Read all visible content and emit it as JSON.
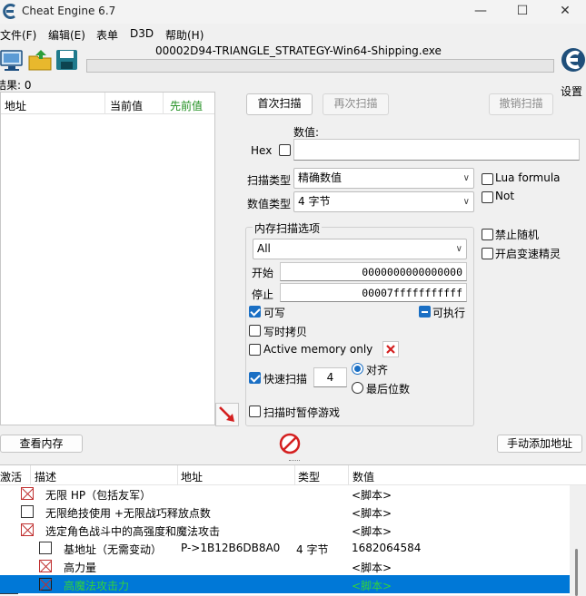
{
  "window": {
    "title": "Cheat Engine 6.7",
    "min": "—",
    "max": "☐",
    "close": "✕"
  },
  "menu": [
    "文件(F)",
    "编辑(E)",
    "表单",
    "D3D",
    "帮助(H)"
  ],
  "process": {
    "name": "00002D94-TRIANGLE_STRATEGY-Win64-Shipping.exe"
  },
  "settings_label": "设置",
  "results_label": "结果: 0",
  "result_headers": {
    "address": "地址",
    "current": "当前值",
    "previous": "先前值"
  },
  "scan_buttons": {
    "first": "首次扫描",
    "next": "再次扫描",
    "undo": "撤销扫描"
  },
  "value": {
    "label": "数值:",
    "hex_label": "Hex",
    "value": ""
  },
  "scan_type": {
    "label": "扫描类型",
    "value": "精确数值"
  },
  "value_type": {
    "label": "数值类型",
    "value": "4 字节"
  },
  "options_right": {
    "lua_formula": "Lua formula",
    "not": "Not",
    "no_random": "禁止随机",
    "speedhack": "开启变速精灵"
  },
  "mem_options": {
    "title": "内存扫描选项",
    "region": "All",
    "start_label": "开始",
    "start_value": "0000000000000000",
    "stop_label": "停止",
    "stop_value": "00007fffffffffff",
    "writable": "可写",
    "executable": "可执行",
    "copy_on_write": "写时拷贝",
    "active_memory": "Active memory only",
    "fast_scan": "快速扫描",
    "fast_scan_value": "4",
    "align": "对齐",
    "last_digits": "最后位数",
    "pause_game": "扫描时暂停游戏"
  },
  "bottom_buttons": {
    "view_memory": "查看内存",
    "add_address": "手动添加地址"
  },
  "table_headers": {
    "active": "激活",
    "desc": "描述",
    "address": "地址",
    "type": "类型",
    "value": "数值"
  },
  "rows": [
    {
      "desc": "无限 HP（包括友军）",
      "address": "",
      "type": "",
      "value": "<脚本>"
    },
    {
      "desc": "无限绝技使用 +无限战巧释放点数",
      "address": "",
      "type": "",
      "value": "<脚本>"
    },
    {
      "desc": "选定角色战斗中的高强度和魔法攻击",
      "address": "",
      "type": "",
      "value": "<脚本>"
    },
    {
      "desc": "基地址（无需变动）",
      "address": "P->1B12B6DB8A0",
      "type": "4 字节",
      "value": "1682064584"
    },
    {
      "desc": "高力量",
      "address": "",
      "type": "",
      "value": "<脚本>"
    },
    {
      "desc": "高魔法攻击力",
      "address": "",
      "type": "",
      "value": "<脚本>"
    }
  ]
}
